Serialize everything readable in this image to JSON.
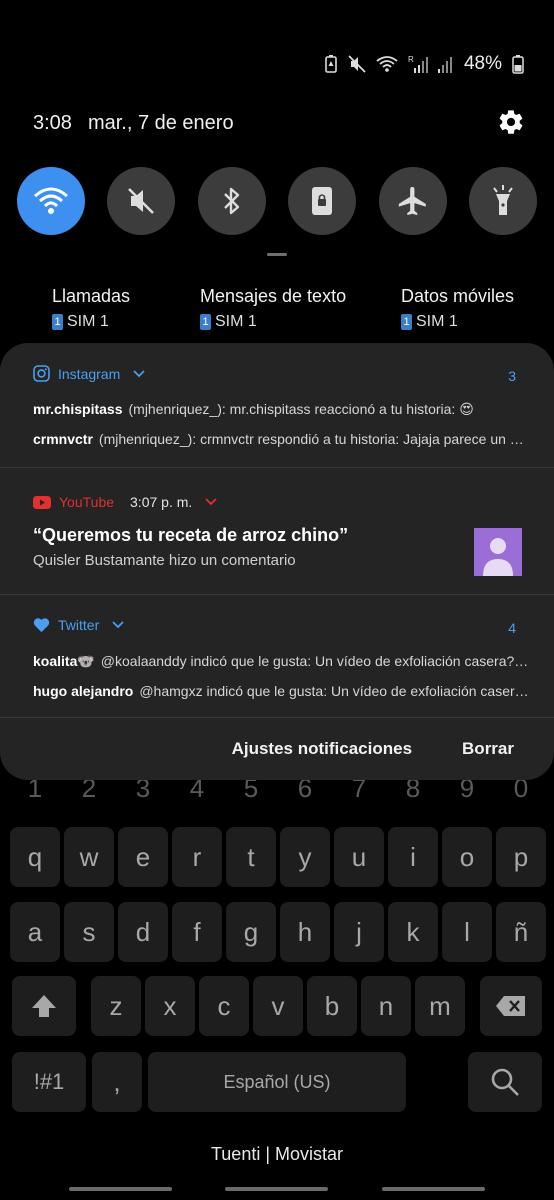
{
  "status": {
    "battery": "48%"
  },
  "header": {
    "time": "3:08",
    "date": "mar., 7 de enero"
  },
  "tiles": [
    {
      "name": "wifi",
      "icon": "wifi-icon",
      "active": true
    },
    {
      "name": "sound",
      "icon": "mute-icon",
      "active": false
    },
    {
      "name": "bluetooth",
      "icon": "bluetooth-icon",
      "active": false
    },
    {
      "name": "rotation",
      "icon": "rotation-lock-icon",
      "active": false
    },
    {
      "name": "airplane",
      "icon": "airplane-icon",
      "active": false
    },
    {
      "name": "flashlight",
      "icon": "flashlight-icon",
      "active": false
    }
  ],
  "sim": [
    {
      "title": "Llamadas",
      "badge": "1",
      "sub": "SIM 1"
    },
    {
      "title": "Mensajes de texto",
      "badge": "1",
      "sub": "SIM 1"
    },
    {
      "title": "Datos móviles",
      "badge": "1",
      "sub": "SIM 1"
    }
  ],
  "notifications": {
    "instagram": {
      "app": "Instagram",
      "count": "3",
      "color": "#4a9ff0",
      "lines": [
        {
          "sender": "mr.chispitass",
          "text": "(mjhenriquez_): mr.chispitass reaccionó a tu historia: 😍"
        },
        {
          "sender": "crmnvctr",
          "text": "(mjhenriquez_): crmnvctr respondió a tu historia: Jajaja parece un osito"
        }
      ]
    },
    "youtube": {
      "app": "YouTube",
      "time": "3:07 p. m.",
      "color": "#e03030",
      "title": "“Queremos tu receta de arroz chino”",
      "subtitle": "Quisler Bustamante hizo un comentario"
    },
    "twitter": {
      "app": "Twitter",
      "count": "4",
      "color": "#4a9ff0",
      "lines": [
        {
          "sender": "koalita🐨",
          "text": "@koalaanddy indicó que le gusta: Un vídeo de exfoliación casera? https://t.co"
        },
        {
          "sender": "hugo alejandro",
          "text": "@hamgxz indicó que le gusta: Un vídeo de exfoliación casera? https://t.co"
        }
      ]
    }
  },
  "actions": {
    "settings": "Ajustes notificaciones",
    "clear": "Borrar"
  },
  "keyboard": {
    "numbers": [
      "1",
      "2",
      "3",
      "4",
      "5",
      "6",
      "7",
      "8",
      "9",
      "0"
    ],
    "row1": [
      "q",
      "w",
      "e",
      "r",
      "t",
      "y",
      "u",
      "i",
      "o",
      "p"
    ],
    "row2": [
      "a",
      "s",
      "d",
      "f",
      "g",
      "h",
      "j",
      "k",
      "l",
      "ñ"
    ],
    "row3": [
      "z",
      "x",
      "c",
      "v",
      "b",
      "n",
      "m"
    ],
    "symbols": "!#1",
    "comma": ",",
    "space": "Español (US)"
  },
  "carrier": "Tuenti | Movistar"
}
